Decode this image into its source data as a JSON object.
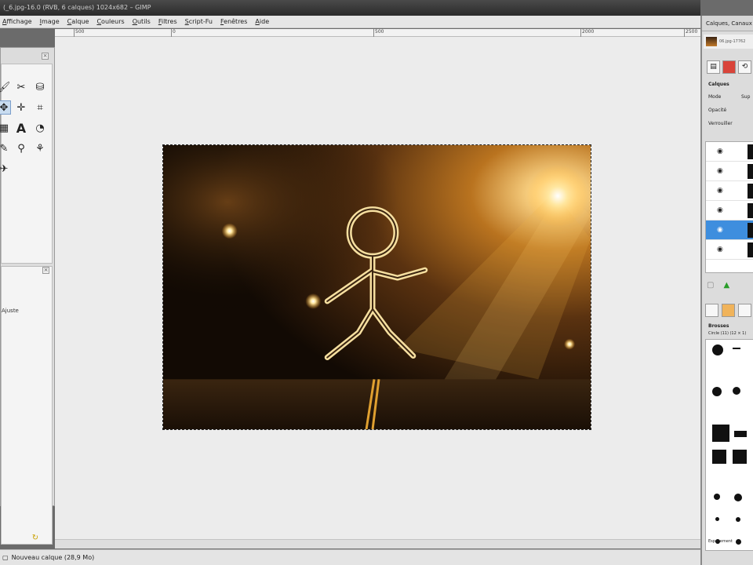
{
  "window": {
    "title": "(_6.jpg-16.0 (RVB, 6 calques) 1024x682 – GIMP"
  },
  "menubar": {
    "items": [
      "Affichage",
      "Image",
      "Calque",
      "Couleurs",
      "Outils",
      "Filtres",
      "Script-Fu",
      "Fenêtres",
      "Aide"
    ]
  },
  "ruler": {
    "ticks": [
      "500",
      "0",
      "500",
      "2000",
      "2500"
    ]
  },
  "toolbox": {
    "options_label": "Ajuste"
  },
  "statusbar": {
    "text": "Nouveau calque (28,9 Mo)"
  },
  "right_panel": {
    "title": "Calques, Canaux",
    "image_name": "06.jpg-17762",
    "layers_heading": "Calques",
    "mode_label": "Mode",
    "mode_value": "Sup",
    "opacity_label": "Opacité",
    "lock_label": "Verrouiller",
    "brushes_heading": "Brosses",
    "brush_name": "Circle (11) (12 × 1)",
    "spacing_label": "Espacement"
  },
  "colors": {
    "menubar_bg": "#e6e6e6",
    "canvas_bg": "#ececec",
    "selected_layer": "#3e8ede",
    "figure_glow": "#f6dfa0"
  }
}
